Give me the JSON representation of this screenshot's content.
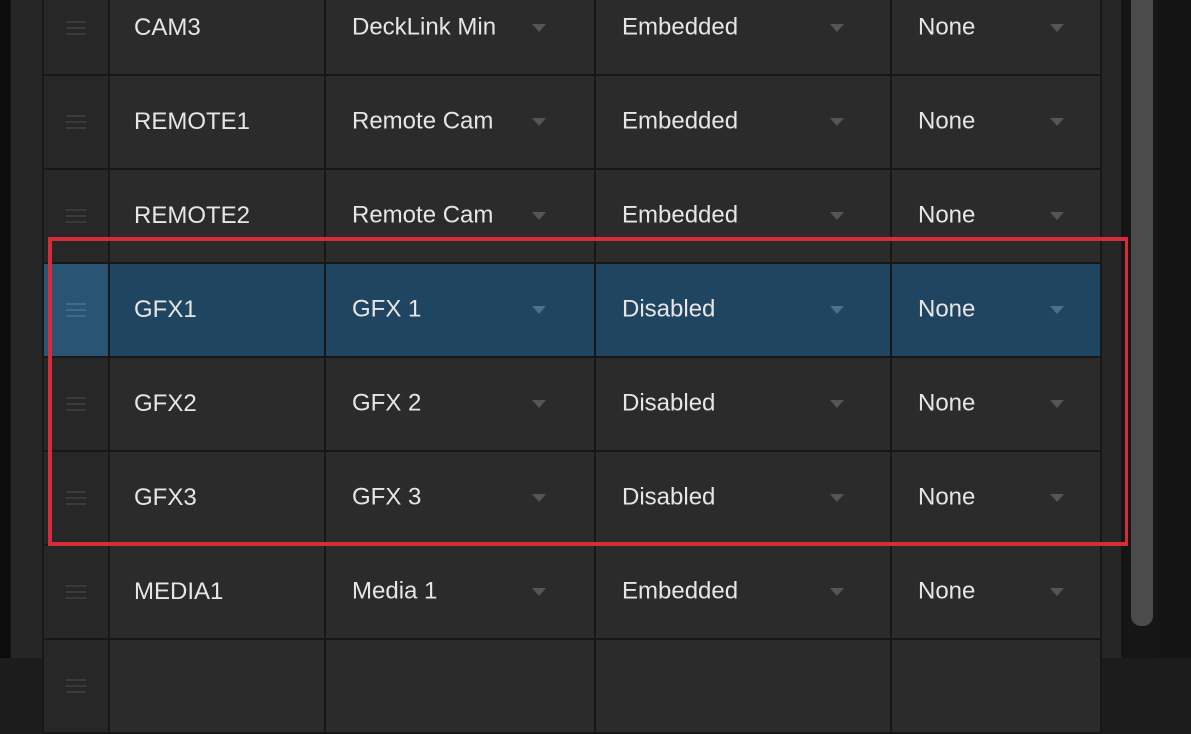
{
  "table": {
    "rows": [
      {
        "name": "CAM3",
        "source": "DeckLink Min",
        "audio": "Embedded",
        "extra": "None",
        "selected": false
      },
      {
        "name": "REMOTE1",
        "source": "Remote Cam",
        "audio": "Embedded",
        "extra": "None",
        "selected": false
      },
      {
        "name": "REMOTE2",
        "source": "Remote Cam",
        "audio": "Embedded",
        "extra": "None",
        "selected": false
      },
      {
        "name": "GFX1",
        "source": "GFX 1",
        "audio": "Disabled",
        "extra": "None",
        "selected": true
      },
      {
        "name": "GFX2",
        "source": "GFX 2",
        "audio": "Disabled",
        "extra": "None",
        "selected": false
      },
      {
        "name": "GFX3",
        "source": "GFX 3",
        "audio": "Disabled",
        "extra": "None",
        "selected": false
      },
      {
        "name": "MEDIA1",
        "source": "Media 1",
        "audio": "Embedded",
        "extra": "None",
        "selected": false
      },
      {
        "name": "",
        "source": "",
        "audio": "",
        "extra": "",
        "selected": false
      }
    ]
  },
  "highlight": {
    "color": "#d62b3a"
  },
  "colors": {
    "selected_row": "#1f4560",
    "row_bg": "#2b2b2b",
    "text": "#e6e6e6"
  }
}
